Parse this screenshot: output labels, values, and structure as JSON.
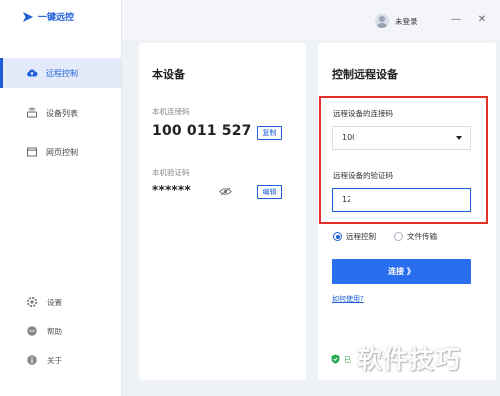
{
  "app": {
    "name": "一键远控"
  },
  "sidebar": {
    "items": [
      {
        "label": "远程控制",
        "icon": "cloud-icon",
        "active": true
      },
      {
        "label": "设备列表",
        "icon": "device-list-icon",
        "active": false
      },
      {
        "label": "网页控制",
        "icon": "web-page-icon",
        "active": false
      }
    ],
    "bottom": [
      {
        "label": "设置",
        "icon": "gear-icon"
      },
      {
        "label": "帮助",
        "icon": "chat-bubble-icon"
      },
      {
        "label": "关于",
        "icon": "info-icon"
      }
    ]
  },
  "titlebar": {
    "user_label": "未登录",
    "minimize": "—",
    "close": "✕"
  },
  "local": {
    "title": "本设备",
    "code_label": "本机连接码",
    "code_value": "100 011 527",
    "copy_label": "复制",
    "verify_label": "本机验证码",
    "verify_value": "******",
    "edit_label": "编辑"
  },
  "remote": {
    "title": "控制远程设备",
    "code_label": "远程设备的连接码",
    "code_value": "100",
    "verify_label": "远程设备的验证码",
    "verify_value": "12",
    "mode_remote": "远程控制",
    "mode_file": "文件传输",
    "connect_label": "连接 》",
    "help_link": "如何使用?",
    "secure_text": "已"
  },
  "watermark": "软件技巧",
  "colors": {
    "accent": "#1f5fd6",
    "button": "#2a6ef0",
    "highlight": "#e2302b",
    "secure": "#2aa952"
  }
}
